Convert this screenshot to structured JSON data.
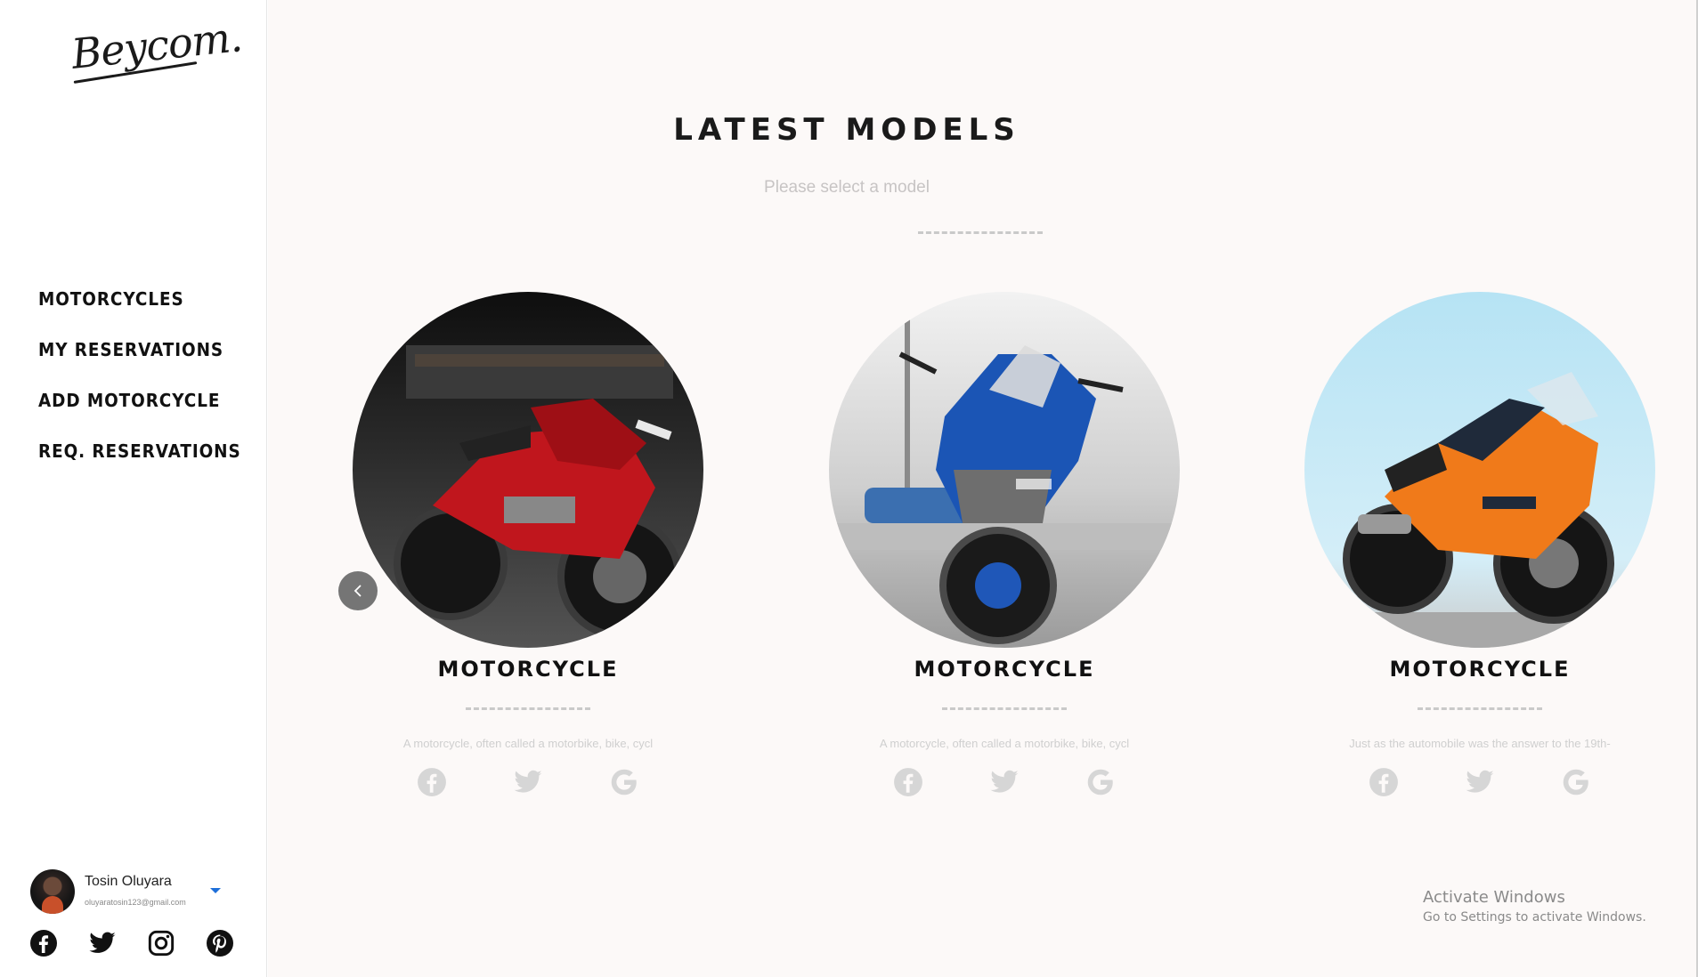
{
  "brand": {
    "logo_text": "Beycom."
  },
  "nav": {
    "items": [
      {
        "label": "MOTORCYCLES"
      },
      {
        "label": "MY RESERVATIONS"
      },
      {
        "label": "ADD MOTORCYCLE"
      },
      {
        "label": "REQ. RESERVATIONS"
      }
    ]
  },
  "user": {
    "name": "Tosin Oluyara",
    "email": "oluyaratosin123@gmail.com"
  },
  "sidebar_socials": [
    "facebook-icon",
    "twitter-icon",
    "instagram-icon",
    "pinterest-icon"
  ],
  "main": {
    "title": "LATEST MODELS",
    "subtitle": "Please select a model"
  },
  "cards": [
    {
      "title": "MOTORCYCLE",
      "description": "A motorcycle, often called a motorbike, bike, cycl",
      "color": "#c0161d"
    },
    {
      "title": "MOTORCYCLE",
      "description": "A motorcycle, often called a motorbike, bike, cycl",
      "color": "#1b55b5"
    },
    {
      "title": "MOTORCYCLE",
      "description": "Just as the automobile was the answer to the 19th-",
      "color": "#f07a1a"
    }
  ],
  "card_icons": [
    "facebook-icon",
    "twitter-icon",
    "google-icon"
  ],
  "watermark": {
    "line1": "Activate Windows",
    "line2": "Go to Settings to activate Windows."
  }
}
